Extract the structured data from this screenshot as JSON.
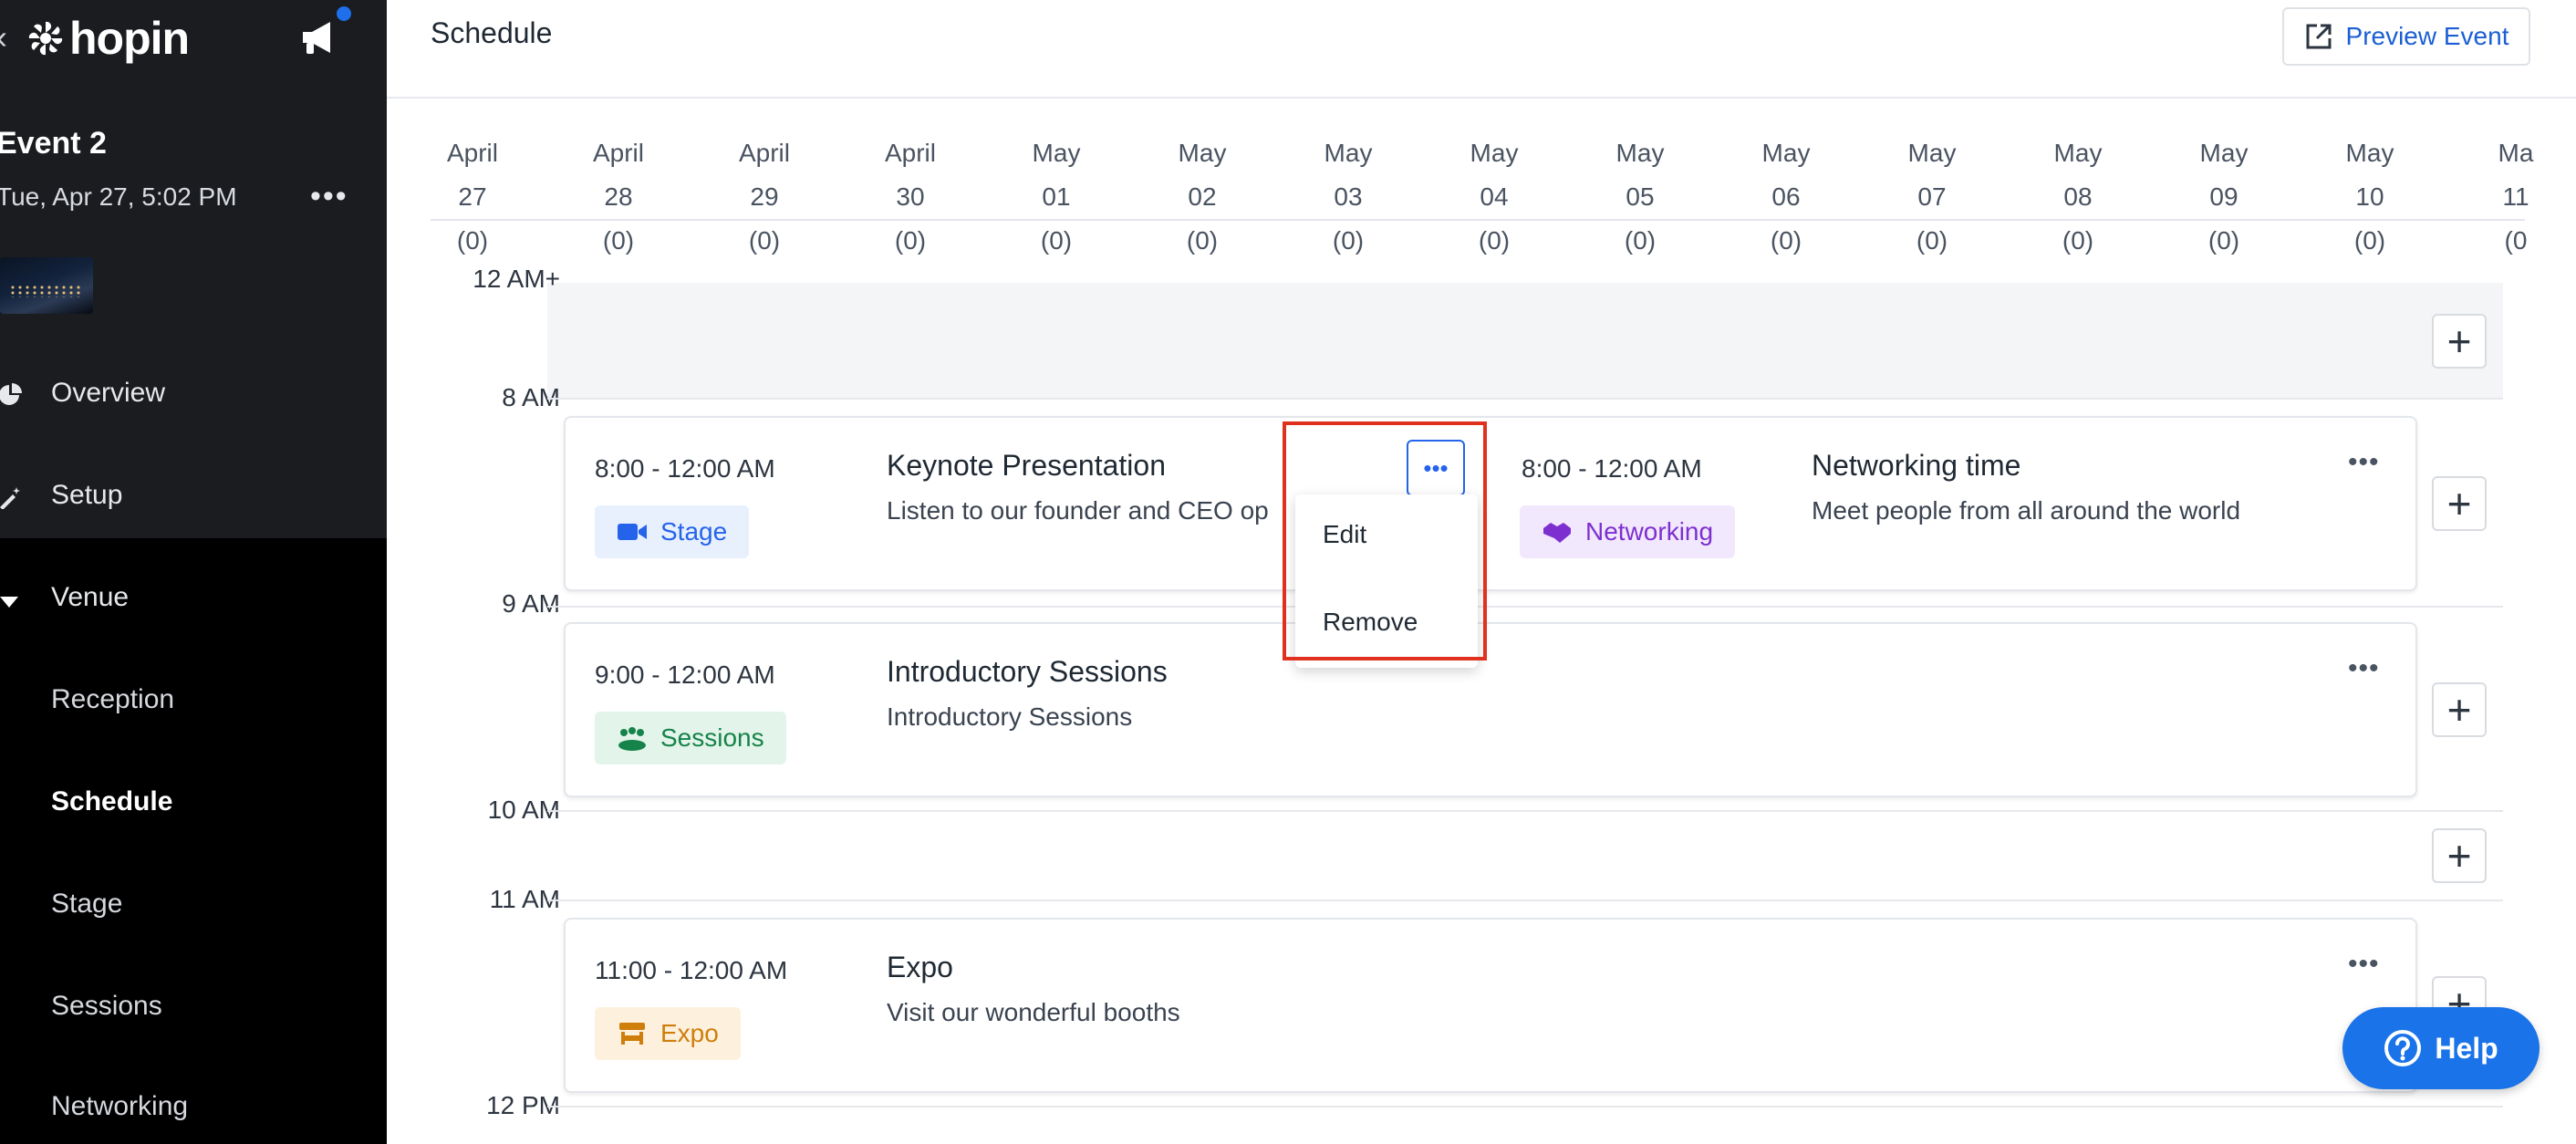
{
  "sidebar": {
    "logo_text": "hopin",
    "event": {
      "name": "Event 2",
      "date": "Tue, Apr 27, 5:02 PM"
    },
    "nav": [
      {
        "label": "Overview",
        "icon": "pie-chart-icon"
      },
      {
        "label": "Setup",
        "icon": "wand-icon"
      },
      {
        "label": "Venue",
        "icon": "caret-down-icon"
      }
    ],
    "venue_items": [
      "Reception",
      "Schedule",
      "Stage",
      "Sessions",
      "Networking"
    ],
    "active_item": "Schedule"
  },
  "header": {
    "title": "Schedule",
    "preview_label": "Preview Event"
  },
  "days": [
    {
      "month": "April",
      "day": "27",
      "count": "(0)"
    },
    {
      "month": "April",
      "day": "28",
      "count": "(0)"
    },
    {
      "month": "April",
      "day": "29",
      "count": "(0)"
    },
    {
      "month": "April",
      "day": "30",
      "count": "(0)"
    },
    {
      "month": "May",
      "day": "01",
      "count": "(0)"
    },
    {
      "month": "May",
      "day": "02",
      "count": "(0)"
    },
    {
      "month": "May",
      "day": "03",
      "count": "(0)"
    },
    {
      "month": "May",
      "day": "04",
      "count": "(0)"
    },
    {
      "month": "May",
      "day": "05",
      "count": "(0)"
    },
    {
      "month": "May",
      "day": "06",
      "count": "(0)"
    },
    {
      "month": "May",
      "day": "07",
      "count": "(0)"
    },
    {
      "month": "May",
      "day": "08",
      "count": "(0)"
    },
    {
      "month": "May",
      "day": "09",
      "count": "(0)"
    },
    {
      "month": "May",
      "day": "10",
      "count": "(0)"
    },
    {
      "month": "Ma",
      "day": "11",
      "count": "(0"
    }
  ],
  "time_labels": [
    "12 AM+",
    "8 AM",
    "9 AM",
    "10 AM",
    "11 AM",
    "12 PM"
  ],
  "slots": {
    "keynote": {
      "time": "8:00 - 12:00 AM",
      "tag": "Stage",
      "title": "Keynote Presentation",
      "description": "Listen to our founder and CEO op"
    },
    "networking": {
      "time": "8:00 - 12:00 AM",
      "tag": "Networking",
      "title": "Networking time",
      "description": "Meet people from all around the world"
    },
    "intro": {
      "time": "9:00 - 12:00 AM",
      "tag": "Sessions",
      "title": "Introductory Sessions",
      "description": "Introductory Sessions"
    },
    "expo": {
      "time": "11:00 - 12:00 AM",
      "tag": "Expo",
      "title": "Expo",
      "description": "Visit our wonderful booths"
    }
  },
  "menu": {
    "edit": "Edit",
    "remove": "Remove"
  },
  "plus_glyph": "+",
  "more_glyph": "•••",
  "help_label": "Help",
  "colors": {
    "accent": "#2563eb",
    "highlight": "#e0301e",
    "help": "#1a73e8"
  }
}
